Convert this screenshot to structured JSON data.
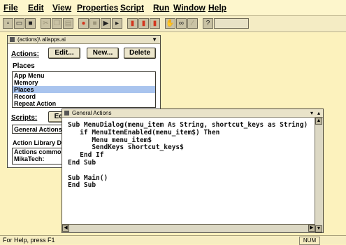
{
  "menu": [
    "File",
    "Edit",
    "View",
    "Properties",
    "Script",
    "Run",
    "Window",
    "Help"
  ],
  "toolbar_icons": [
    "new-icon",
    "open-icon",
    "save-icon",
    "cut-icon",
    "copy-icon",
    "paste-icon",
    "record-icon",
    "stop-icon",
    "play-icon",
    "step-icon",
    "red-a-icon",
    "red-b-icon",
    "red-c-icon",
    "hand-icon",
    "binoculars-icon",
    "wand-icon",
    "help-icon",
    "blank-icon"
  ],
  "actions_window": {
    "title": "(actions)\\ allapps.ai",
    "actions_label": "Actions:",
    "buttons": {
      "edit": "Edit...",
      "new": "New...",
      "delete": "Delete"
    },
    "category": "Places",
    "list": [
      "App Menu",
      "Memory",
      "Places",
      "Record",
      "Repeat Action"
    ],
    "selected_index": 2,
    "scripts_label": "Scripts:",
    "scripts_button": "Ed",
    "scripts_value": "General Actions",
    "library_label": "Action Library D",
    "library_text": [
      "Actions commo",
      "MikaTech:"
    ]
  },
  "editor_window": {
    "title": "General Actions",
    "code": [
      "Sub MenuDialog(menu_item As String, shortcut_keys as String)",
      "   if MenuItemEnabled(menu_item$) Then",
      "      Menu menu_item$",
      "      SendKeys shortcut_keys$",
      "   End If",
      "End Sub",
      "",
      "Sub Main()",
      "End Sub"
    ]
  },
  "status": {
    "help_text": "For Help, press F1",
    "num": "NUM"
  }
}
